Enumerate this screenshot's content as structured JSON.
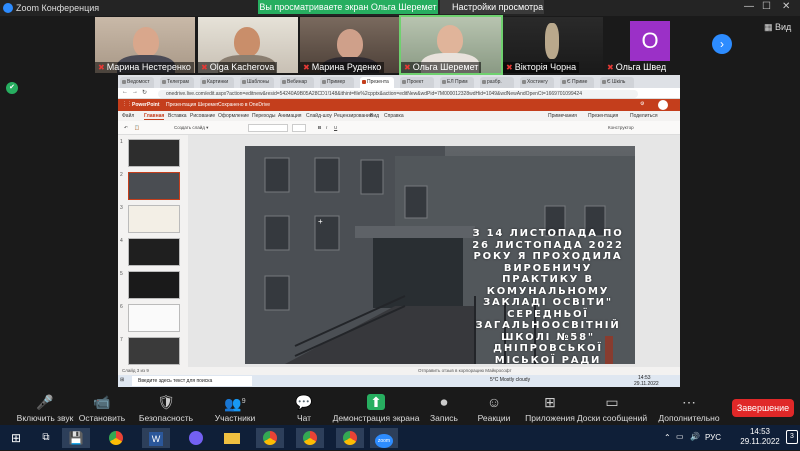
{
  "zoom": {
    "title": "Zoom Конференция",
    "share_banner": "Вы просматриваете экран Ольга Шеремет",
    "view_options": "Настройки просмотра",
    "view_label": "Вид"
  },
  "participants": [
    {
      "name": "Марина Нестеренко",
      "muted": true
    },
    {
      "name": "Olga Kacherova",
      "muted": true
    },
    {
      "name": "Марина Руденко",
      "muted": true
    },
    {
      "name": "Ольга Шеремет",
      "muted": true
    },
    {
      "name": "Вікторія Чорна",
      "muted": true
    },
    {
      "name": "Ольга Швед",
      "muted": true,
      "initial": "O"
    }
  ],
  "browser": {
    "tabs": [
      "Ведомост",
      "Телеграм",
      "Картинки",
      "Шаблоны",
      "Вебинар",
      "Пример",
      "Презента",
      "Прoект",
      "ЕЛ Прим",
      "разбр.",
      "Хостингу",
      "Є Приме",
      "Є Шкіль"
    ],
    "url": "onedrive.live.com/edit.aspx?action=editnew&resid=54240A9B05A28CD1!148&ithint=file%2cpptx&action=editNew&wdPid=7M000012328wdHid=1049&wdNewAndOpenCt=1669701099424"
  },
  "powerpoint": {
    "app_name": "PowerPoint",
    "doc_name": "Презентация Шеремет",
    "saved_status": "Сохранено в OneDrive",
    "menu": [
      "Файл",
      "Главная",
      "Вставка",
      "Рисование",
      "Оформление",
      "Переходы",
      "Анимация",
      "Слайд-шоу",
      "Рецензирование",
      "Вид",
      "Справка"
    ],
    "comments": "Примечания",
    "share": "Поделиться",
    "present": "Презентация",
    "designer": "Конструктор",
    "slide_text": "З 14 ЛИСТОПАДА ПО 26 ЛИСТОПАДА 2022 РОКУ Я ПРОХОДИЛА ВИРОБНИЧУ ПРАКТИКУ В КОМУНАЛЬНОМУ ЗАКЛАДІ ОСВІТИ\" СЕРЕДНЬОЇ ЗАГАЛЬНООСВІТНІЙ ШКОЛІ №58\" ДНІПРОВСЬКОЇ МІСЬКОЇ РАДИ",
    "status_left": "Слайд 3 из 9",
    "status_right": "Отправить отзыв в корпорацию Майкрософт"
  },
  "inner_taskbar": {
    "search": "Введите здесь текст для поиска",
    "weather": "5°C  Mostly cloudy",
    "time": "14:53",
    "date": "29.11.2022"
  },
  "toolbar": [
    {
      "label": "Включить звук",
      "icon": "mic-off-icon"
    },
    {
      "label": "Остановить видео",
      "icon": "video-icon"
    },
    {
      "label": "Безопасность",
      "icon": "shield-icon"
    },
    {
      "label": "Участники",
      "icon": "participants-icon",
      "count": "9"
    },
    {
      "label": "Чат",
      "icon": "chat-icon"
    },
    {
      "label": "Демонстрация экрана",
      "icon": "share-screen-icon"
    },
    {
      "label": "Запись",
      "icon": "record-icon"
    },
    {
      "label": "Реакции",
      "icon": "reactions-icon"
    },
    {
      "label": "Приложения",
      "icon": "apps-icon"
    },
    {
      "label": "Доски сообщений",
      "icon": "whiteboard-icon"
    },
    {
      "label": "Дополнительно",
      "icon": "more-icon"
    }
  ],
  "end_button": "Завершение",
  "taskbar": {
    "lang": "РУС",
    "time": "14:53",
    "date": "29.11.2022",
    "notification_count": "3"
  },
  "colors": {
    "zoom_green": "#27ae60",
    "end_red": "#e02828",
    "powerpoint": "#c43e1c"
  }
}
